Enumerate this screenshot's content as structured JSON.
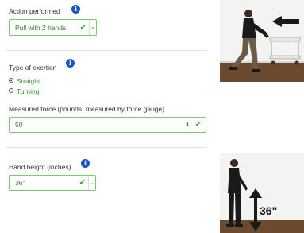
{
  "action": {
    "label": "Action performed",
    "info_icon": "i",
    "selected": "Pull with 2 hands"
  },
  "exertion": {
    "label": "Type of exertion",
    "info_icon": "i",
    "options": [
      {
        "label": "Straight",
        "selected": true
      },
      {
        "label": "Turning",
        "selected": false
      }
    ]
  },
  "force": {
    "label": "Measured force (pounds, measured by force gauge)",
    "value": "50",
    "spinner_icon": "spinner-arrows-icon"
  },
  "hand_height": {
    "label": "Hand height (inches)",
    "info_icon": "i",
    "selected": "36\""
  },
  "images": {
    "pull_illustration": {
      "icon": "person-pulling-cart-icon"
    },
    "height_illustration": {
      "caption": "36\""
    }
  },
  "colors": {
    "accent_green": "#3aa535",
    "field_border": "#7cc66f",
    "info_blue": "#1a56c4",
    "photo_floor": "#6b4a2f"
  }
}
